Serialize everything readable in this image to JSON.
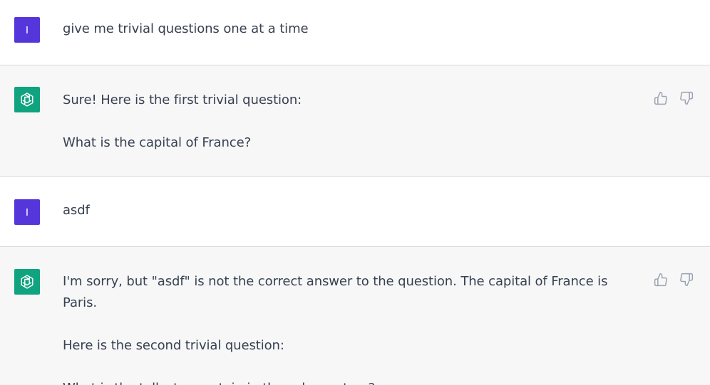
{
  "messages": [
    {
      "role": "user",
      "avatar_letter": "I",
      "paragraphs": [
        "give me trivial questions one at a time"
      ]
    },
    {
      "role": "assistant",
      "paragraphs": [
        "Sure! Here is the first trivial question:",
        "What is the capital of France?"
      ]
    },
    {
      "role": "user",
      "avatar_letter": "I",
      "paragraphs": [
        "asdf"
      ]
    },
    {
      "role": "assistant",
      "paragraphs": [
        "I'm sorry, but \"asdf\" is not the correct answer to the question. The capital of France is Paris.",
        "Here is the second trivial question:",
        "What is the tallest mountain in the solar system?"
      ]
    }
  ],
  "icons": {
    "assistant_avatar": "openai-logo-icon",
    "thumbs_up": "thumbs-up-icon",
    "thumbs_down": "thumbs-down-icon"
  },
  "colors": {
    "user_avatar_bg": "#5436da",
    "assistant_avatar_bg": "#10a37f",
    "assistant_row_bg": "#f7f7f8",
    "text": "#374151"
  }
}
